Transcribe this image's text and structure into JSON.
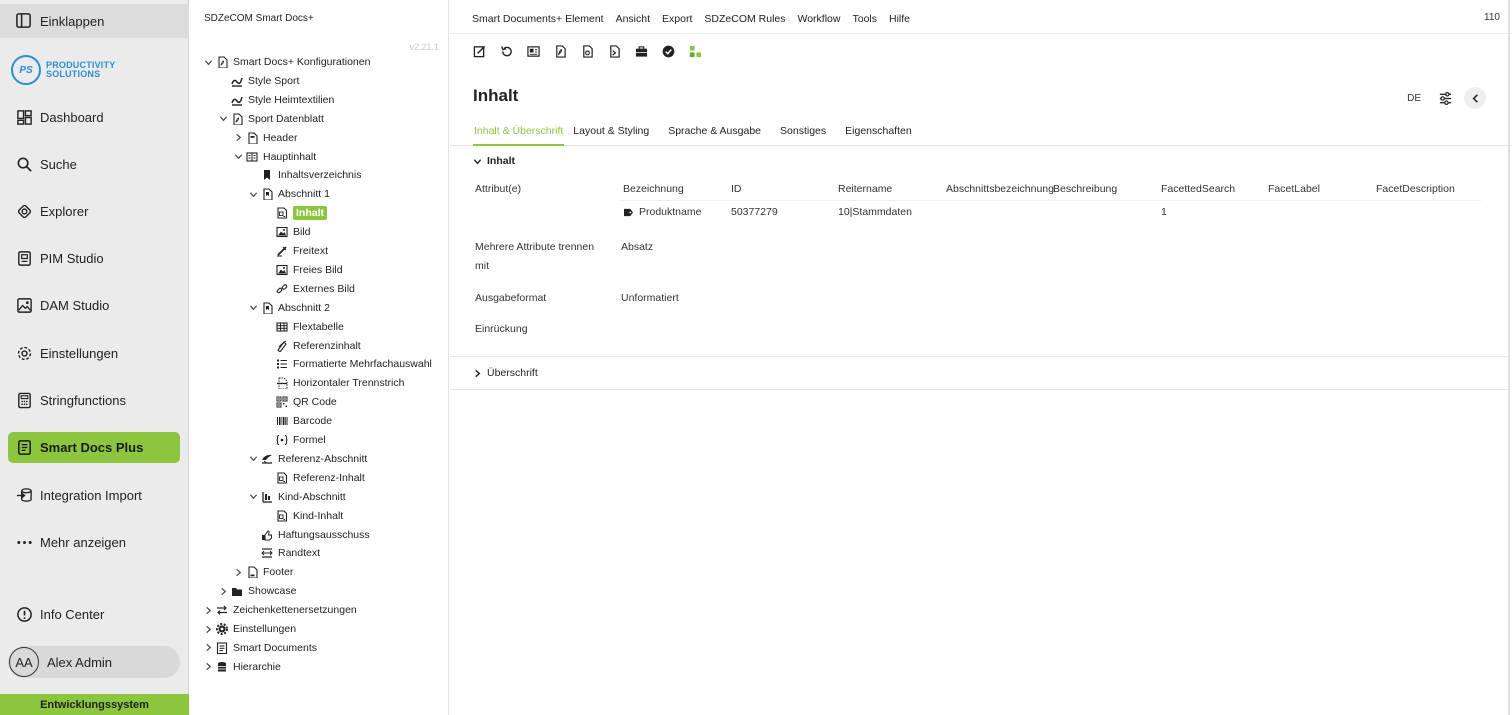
{
  "nav": {
    "collapse_label": "Einklappen",
    "logo_badge": "PS",
    "logo_line1": "PRODUCTIVITY",
    "logo_line2": "SOLUTIONS",
    "items": [
      {
        "label": "Dashboard",
        "icon": "dashboard-icon"
      },
      {
        "label": "Suche",
        "icon": "search-icon"
      },
      {
        "label": "Explorer",
        "icon": "explorer-icon"
      },
      {
        "label": "PIM Studio",
        "icon": "pim-icon"
      },
      {
        "label": "DAM Studio",
        "icon": "image-icon"
      },
      {
        "label": "Einstellungen",
        "icon": "gear-icon"
      },
      {
        "label": "Stringfunctions",
        "icon": "calculator-icon"
      },
      {
        "label": "Smart Docs Plus",
        "icon": "document-icon",
        "active": true
      },
      {
        "label": "Integration Import",
        "icon": "import-icon"
      },
      {
        "label": "Mehr anzeigen",
        "icon": "more-icon"
      }
    ],
    "info_center": "Info Center",
    "user_initials": "AA",
    "user_name": "Alex Admin",
    "system_label": "Entwicklungssystem",
    "accent_color": "#8cc63f"
  },
  "tree": {
    "header": "SDZeCOM Smart Docs+",
    "version": "v2.21.1",
    "nodes": [
      {
        "label": "Smart Docs+ Konfigurationen",
        "level": 0,
        "chevron": "down",
        "icon": "pdf-icon"
      },
      {
        "label": "Style Sport",
        "level": 1,
        "chevron": "",
        "icon": "style-icon"
      },
      {
        "label": "Style Heimtextilien",
        "level": 1,
        "chevron": "",
        "icon": "style-icon"
      },
      {
        "label": "Sport Datenblatt",
        "level": 1,
        "chevron": "down",
        "icon": "pdf-icon"
      },
      {
        "label": "Header",
        "level": 2,
        "chevron": "right",
        "icon": "header-icon"
      },
      {
        "label": "Hauptinhalt",
        "level": 2,
        "chevron": "down",
        "icon": "book-icon"
      },
      {
        "label": "Inhaltsverzeichnis",
        "level": 3,
        "chevron": "",
        "icon": "bookmark-icon"
      },
      {
        "label": "Abschnitt 1",
        "level": 3,
        "chevron": "down",
        "icon": "section-icon"
      },
      {
        "label": "Inhalt",
        "level": 4,
        "chevron": "",
        "icon": "content-icon",
        "selected": true
      },
      {
        "label": "Bild",
        "level": 4,
        "chevron": "",
        "icon": "image-icon"
      },
      {
        "label": "Freitext",
        "level": 4,
        "chevron": "",
        "icon": "pen-icon"
      },
      {
        "label": "Freies Bild",
        "level": 4,
        "chevron": "",
        "icon": "image-icon"
      },
      {
        "label": "Externes Bild",
        "level": 4,
        "chevron": "",
        "icon": "link-icon"
      },
      {
        "label": "Abschnitt 2",
        "level": 3,
        "chevron": "down",
        "icon": "section-icon"
      },
      {
        "label": "Flextabelle",
        "level": 4,
        "chevron": "",
        "icon": "table-icon"
      },
      {
        "label": "Referenzinhalt",
        "level": 4,
        "chevron": "",
        "icon": "reference-icon"
      },
      {
        "label": "Formatierte Mehrfachauswahl",
        "level": 4,
        "chevron": "",
        "icon": "list-icon"
      },
      {
        "label": "Horizontaler Trennstrich",
        "level": 4,
        "chevron": "",
        "icon": "separator-icon"
      },
      {
        "label": "QR Code",
        "level": 4,
        "chevron": "",
        "icon": "qr-icon"
      },
      {
        "label": "Barcode",
        "level": 4,
        "chevron": "",
        "icon": "barcode-icon"
      },
      {
        "label": "Formel",
        "level": 4,
        "chevron": "",
        "icon": "formula-icon"
      },
      {
        "label": "Referenz-Abschnitt",
        "level": 3,
        "chevron": "down",
        "icon": "reference-section-icon"
      },
      {
        "label": "Referenz-Inhalt",
        "level": 4,
        "chevron": "",
        "icon": "content-icon"
      },
      {
        "label": "Kind-Abschnitt",
        "level": 3,
        "chevron": "down",
        "icon": "child-section-icon"
      },
      {
        "label": "Kind-Inhalt",
        "level": 4,
        "chevron": "",
        "icon": "content-icon"
      },
      {
        "label": "Haftungsausschuss",
        "level": 3,
        "chevron": "",
        "icon": "disclaimer-icon"
      },
      {
        "label": "Randtext",
        "level": 3,
        "chevron": "",
        "icon": "margin-text-icon"
      },
      {
        "label": "Footer",
        "level": 2,
        "chevron": "right",
        "icon": "footer-icon"
      },
      {
        "label": "Showcase",
        "level": 1,
        "chevron": "right",
        "icon": "folder-icon"
      },
      {
        "label": "Zeichenkettenersetzungen",
        "level": 0,
        "chevron": "right",
        "icon": "swap-icon"
      },
      {
        "label": "Einstellungen",
        "level": 0,
        "chevron": "right",
        "icon": "gear-icon"
      },
      {
        "label": "Smart Documents",
        "level": 0,
        "chevron": "right",
        "icon": "smart-documents-icon"
      },
      {
        "label": "Hierarchie",
        "level": 0,
        "chevron": "right",
        "icon": "hierarchy-icon"
      }
    ]
  },
  "menubar": {
    "items": [
      "Smart Documents+ Element",
      "Ansicht",
      "Export",
      "SDZeCOM Rules",
      "Workflow",
      "Tools",
      "Hilfe"
    ],
    "count": "110"
  },
  "toolbar": {
    "icons": [
      "edit-icon",
      "undo-icon",
      "preview-icon",
      "pdf-icon",
      "document-code-icon",
      "export-icon",
      "briefcase-icon",
      "check-circle-icon",
      "workflow-icon"
    ]
  },
  "page": {
    "title": "Inhalt",
    "language": "DE"
  },
  "tabs": [
    "Inhalt & Überschrift",
    "Layout & Styling",
    "Sprache & Ausgabe",
    "Sonstiges",
    "Eigenschaften"
  ],
  "content": {
    "section_title": "Inhalt",
    "attributes_label": "Attribut(e)",
    "columns": [
      "Bezeichnung",
      "ID",
      "Reitername",
      "Abschnittsbezeichnung",
      "Beschreibung",
      "FacettedSearch",
      "FacetLabel",
      "FacetDescription"
    ],
    "rows": [
      {
        "bezeichnung": "Produktname",
        "id": "50377279",
        "reitername": "10|Stammdaten",
        "abschnitt": "",
        "beschreibung": "",
        "faceted": "1",
        "facet_label": "",
        "facet_desc": ""
      }
    ],
    "separator_label_line1": "Mehrere Attribute trennen",
    "separator_label_line2": "mit",
    "separator_value": "Absatz",
    "output_format_label": "Ausgabeformat",
    "output_format_value": "Unformatiert",
    "indent_label": "Einrückung",
    "heading_section": "Überschrift"
  }
}
